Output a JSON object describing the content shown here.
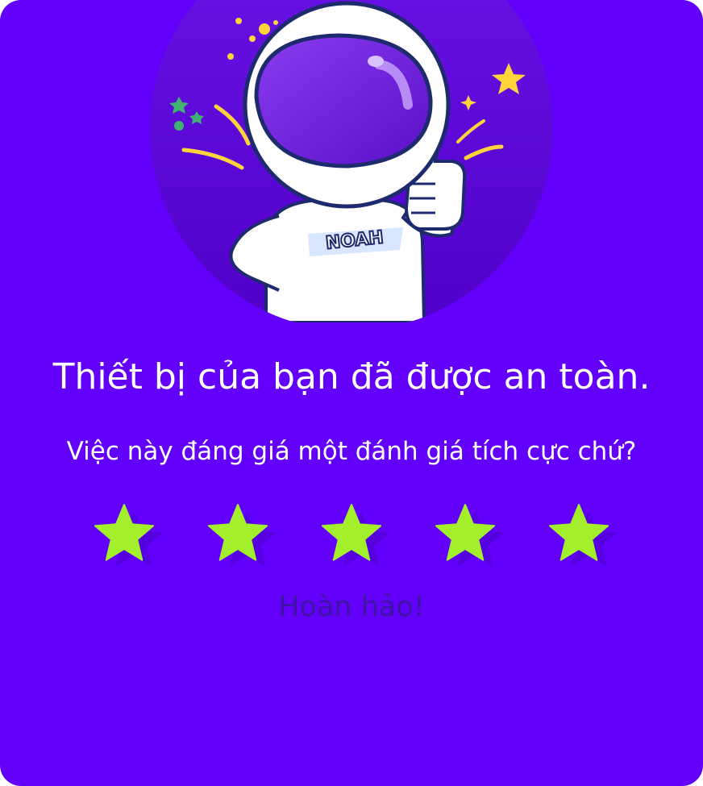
{
  "dialog": {
    "title": "Thiết bị của bạn đã được an toàn.",
    "subtitle": "Việc này đáng giá một đánh giá tích cực chứ?",
    "rating_text": "Hoàn hảo!",
    "mascot_label": "NOAH"
  },
  "rating": {
    "value": 5,
    "max": 5
  },
  "colors": {
    "background": "#6200fc",
    "star": "#a3ef2c",
    "rating_text": "#3f13a3"
  },
  "icons": {
    "star": "star-icon",
    "mascot": "astronaut-thumbs-up-icon"
  }
}
